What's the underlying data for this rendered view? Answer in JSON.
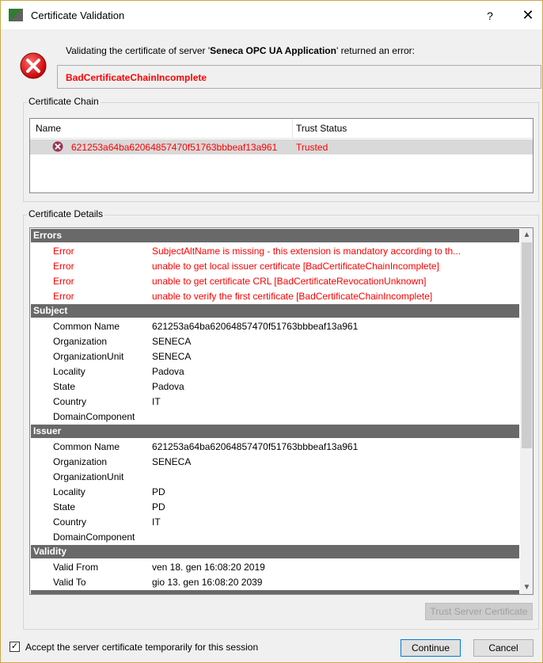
{
  "window": {
    "title": "Certificate Validation",
    "help": "?",
    "close": "✕"
  },
  "message": {
    "prefix": "Validating the certificate of server '",
    "server": "Seneca OPC UA Application",
    "suffix": "' returned an error:",
    "error_code": "BadCertificateChainIncomplete"
  },
  "chain": {
    "group_label": "Certificate Chain",
    "columns": [
      "Name",
      "Trust Status"
    ],
    "rows": [
      {
        "name": "621253a64ba62064857470f51763bbbeaf13a961",
        "status": "Trusted"
      }
    ]
  },
  "details": {
    "group_label": "Certificate Details",
    "errors_header": "Errors",
    "errors": [
      {
        "key": "Error",
        "value": "SubjectAltName is missing - this extension is mandatory according to th..."
      },
      {
        "key": "Error",
        "value": "unable to get local issuer certificate [BadCertificateChainIncomplete]"
      },
      {
        "key": "Error",
        "value": "unable to get certificate CRL [BadCertificateRevocationUnknown]"
      },
      {
        "key": "Error",
        "value": "unable to verify the first certificate [BadCertificateChainIncomplete]"
      }
    ],
    "subject_header": "Subject",
    "subject": [
      {
        "key": "Common Name",
        "value": "621253a64ba62064857470f51763bbbeaf13a961"
      },
      {
        "key": "Organization",
        "value": "SENECA"
      },
      {
        "key": "OrganizationUnit",
        "value": "SENECA"
      },
      {
        "key": "Locality",
        "value": "Padova"
      },
      {
        "key": "State",
        "value": "Padova"
      },
      {
        "key": "Country",
        "value": "IT"
      },
      {
        "key": "DomainComponent",
        "value": ""
      }
    ],
    "issuer_header": "Issuer",
    "issuer": [
      {
        "key": "Common Name",
        "value": "621253a64ba62064857470f51763bbbeaf13a961"
      },
      {
        "key": "Organization",
        "value": "SENECA"
      },
      {
        "key": "OrganizationUnit",
        "value": ""
      },
      {
        "key": "Locality",
        "value": "PD"
      },
      {
        "key": "State",
        "value": "PD"
      },
      {
        "key": "Country",
        "value": "IT"
      },
      {
        "key": "DomainComponent",
        "value": ""
      }
    ],
    "validity_header": "Validity",
    "validity": [
      {
        "key": "Valid From",
        "value": "ven 18. gen 16:08:20 2019"
      },
      {
        "key": "Valid To",
        "value": "gio 13. gen 16:08:20 2039"
      }
    ]
  },
  "buttons": {
    "trust": "Trust Server Certificate",
    "continue": "Continue",
    "cancel": "Cancel"
  },
  "accept": {
    "checked": true,
    "label": "Accept the server certificate temporarily for this session"
  }
}
